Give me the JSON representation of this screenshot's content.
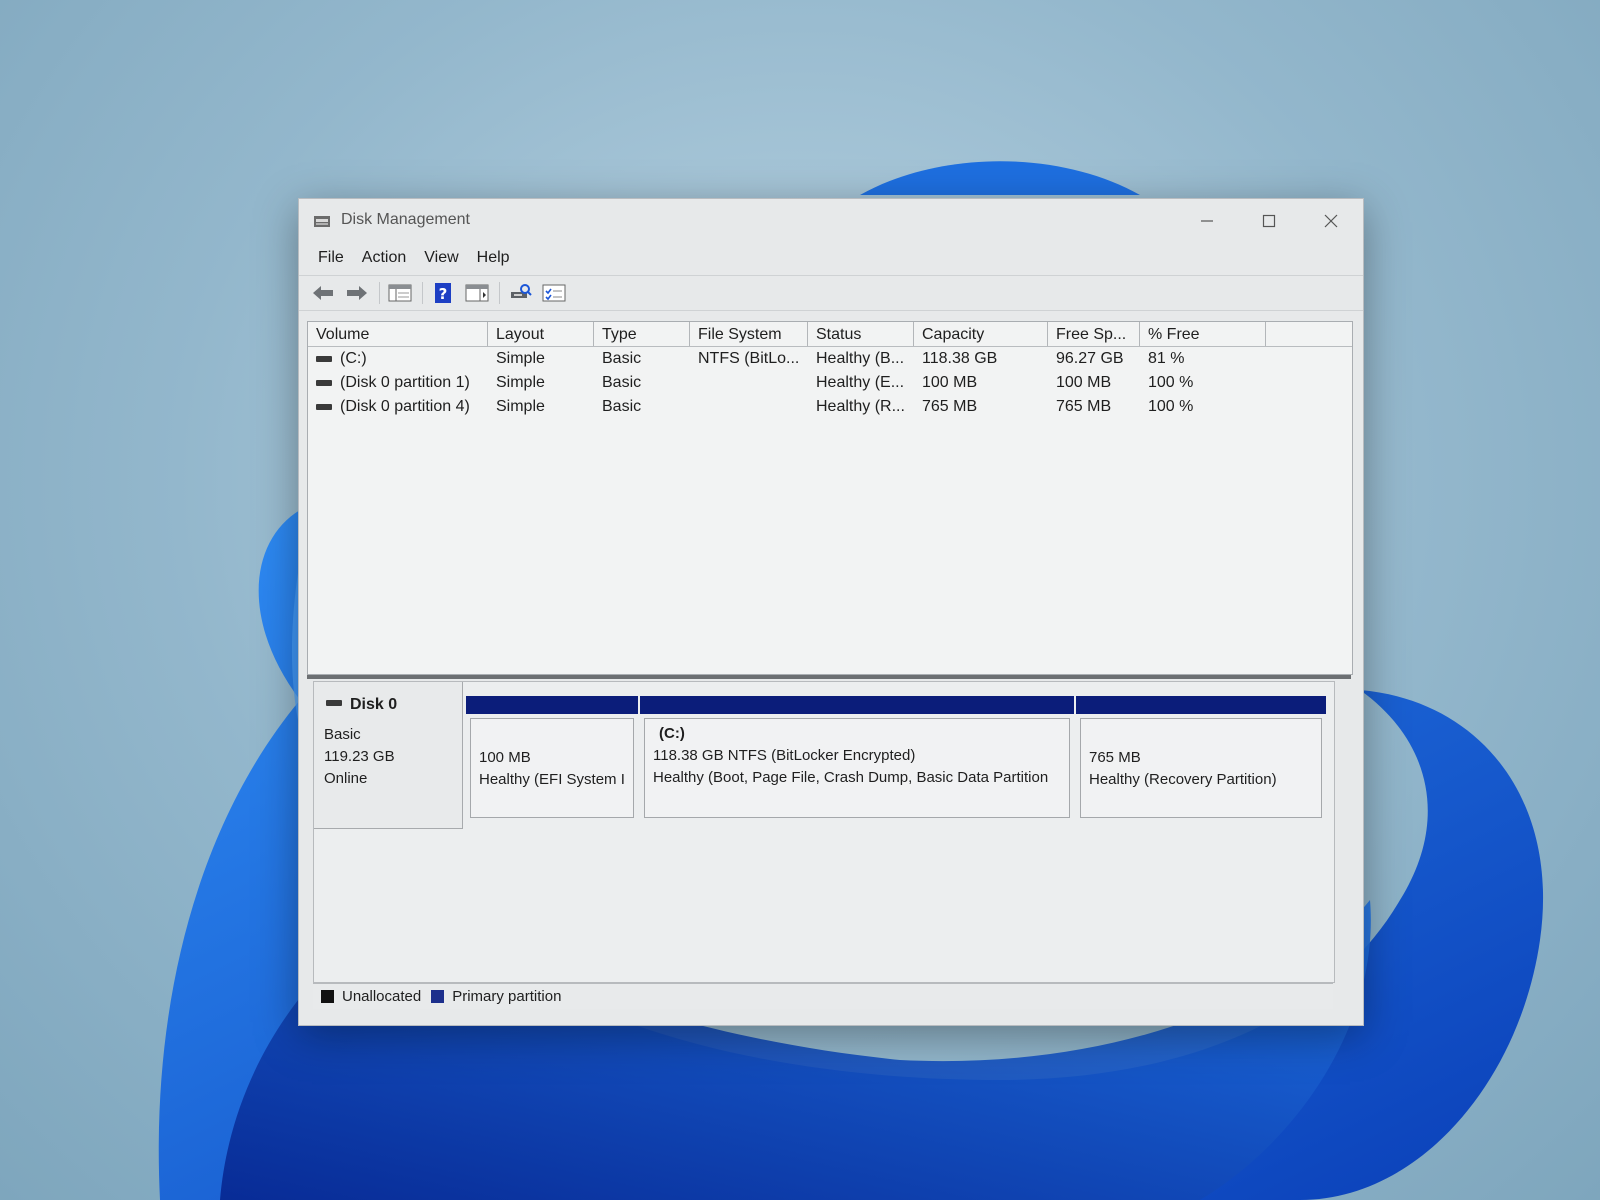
{
  "window": {
    "title": "Disk Management",
    "controls": {
      "minimize": "minimize",
      "maximize": "maximize",
      "close": "close"
    }
  },
  "menu": [
    "File",
    "Action",
    "View",
    "Help"
  ],
  "toolbar": [
    "back-arrow-icon",
    "forward-arrow-icon",
    "volume-list-icon",
    "help-icon",
    "console-tree-icon",
    "rescan-disks-icon",
    "properties-icon"
  ],
  "volume_table": {
    "headers": [
      "Volume",
      "Layout",
      "Type",
      "File System",
      "Status",
      "Capacity",
      "Free Sp...",
      "% Free"
    ],
    "rows": [
      [
        "(C:)",
        "Simple",
        "Basic",
        "NTFS (BitLo...",
        "Healthy (B...",
        "118.38 GB",
        "96.27 GB",
        "81 %"
      ],
      [
        "(Disk 0 partition 1)",
        "Simple",
        "Basic",
        "",
        "Healthy (E...",
        "100 MB",
        "100 MB",
        "100 %"
      ],
      [
        "(Disk 0 partition 4)",
        "Simple",
        "Basic",
        "",
        "Healthy (R...",
        "765 MB",
        "765 MB",
        "100 %"
      ]
    ]
  },
  "disk": {
    "name": "Disk 0",
    "type": "Basic",
    "size": "119.23 GB",
    "state": "Online",
    "partitions": [
      {
        "title": "",
        "line1": "100 MB",
        "line2": "Healthy (EFI System I"
      },
      {
        "title": "(C:)",
        "line1": "118.38 GB NTFS (BitLocker Encrypted)",
        "line2": "Healthy (Boot, Page File, Crash Dump, Basic Data Partition"
      },
      {
        "title": "",
        "line1": "765 MB",
        "line2": "Healthy (Recovery Partition)"
      }
    ]
  },
  "legend": [
    {
      "label": "Unallocated",
      "color": "#111111"
    },
    {
      "label": "Primary partition",
      "color": "#1c2f8c"
    }
  ],
  "colors": {
    "partition_bar": "#0b1d7a",
    "accent": "#1c2f8c"
  }
}
